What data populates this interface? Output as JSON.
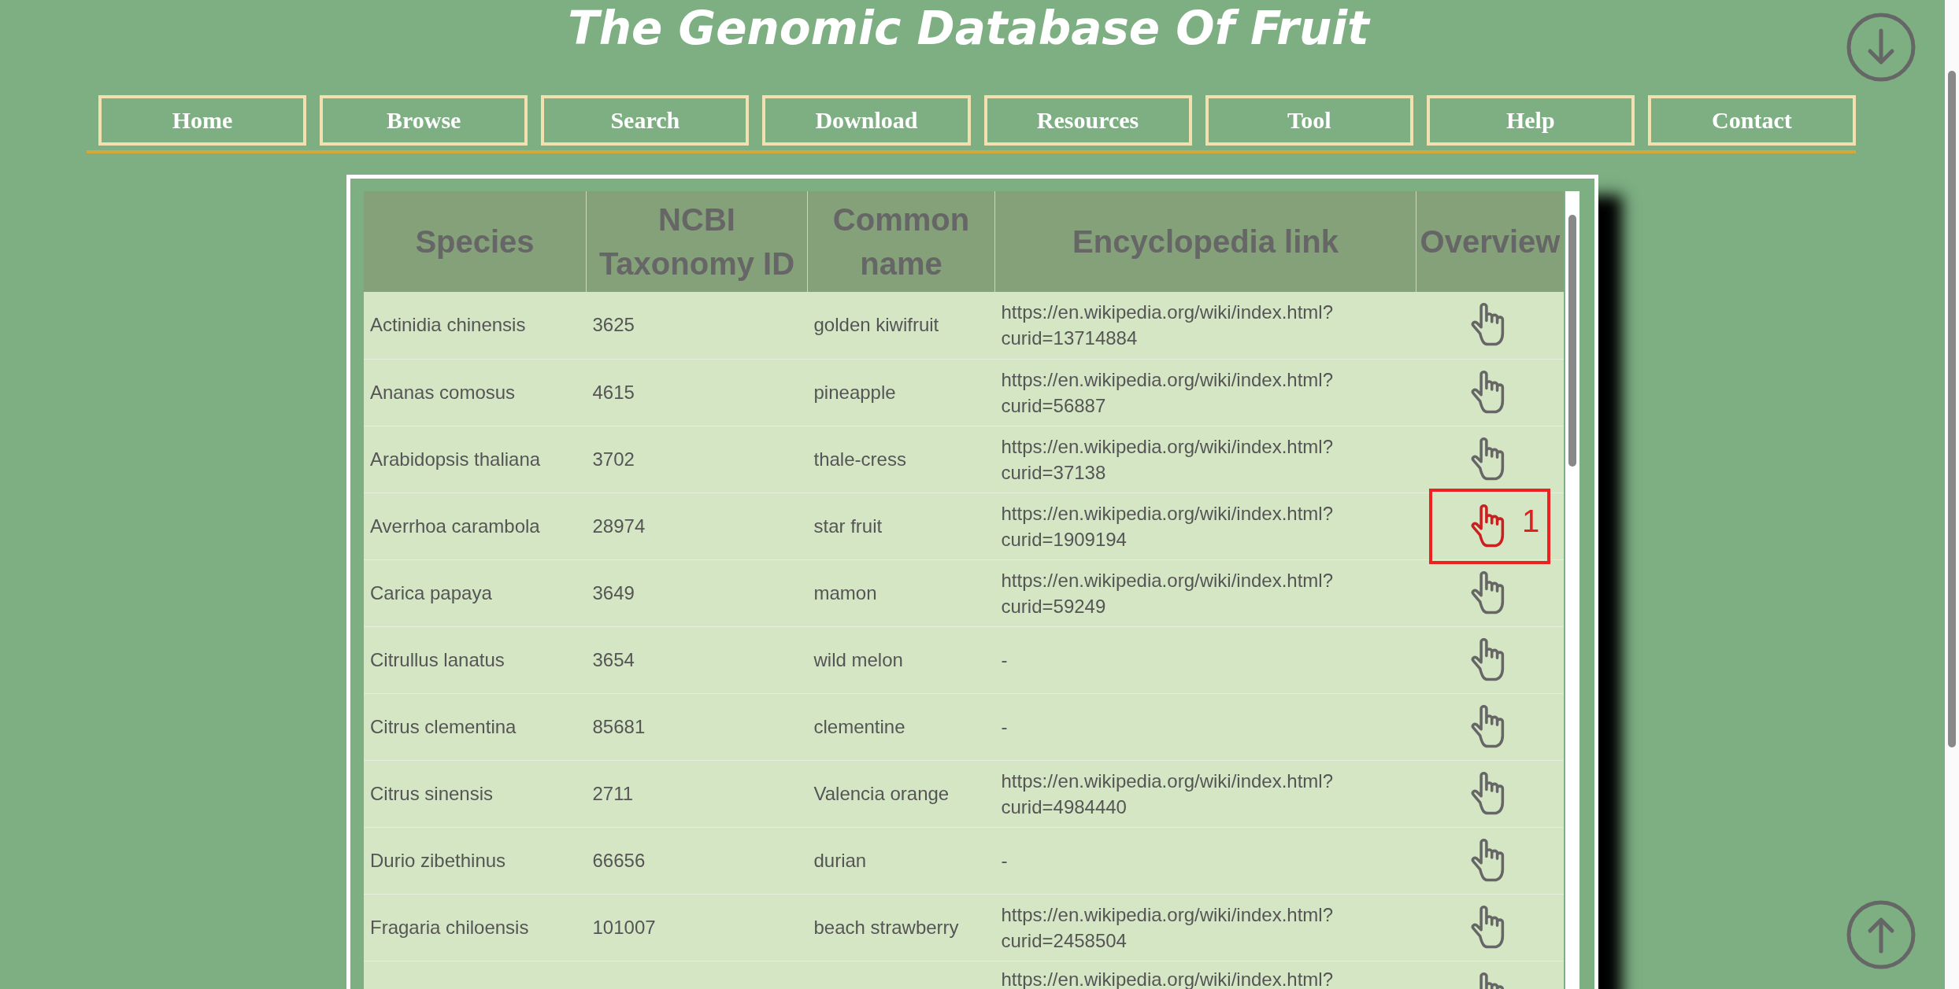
{
  "title": "The Genomic Database Of Fruit",
  "nav": [
    {
      "label": "Home"
    },
    {
      "label": "Browse"
    },
    {
      "label": "Search"
    },
    {
      "label": "Download"
    },
    {
      "label": "Resources"
    },
    {
      "label": "Tool"
    },
    {
      "label": "Help"
    },
    {
      "label": "Contact"
    }
  ],
  "table": {
    "columns": [
      "Species",
      "NCBI Taxonomy ID",
      "Common name",
      "Encyclopedia link",
      "Overview"
    ],
    "rows": [
      {
        "species": "Actinidia chinensis",
        "taxid": "3625",
        "common": "golden kiwifruit",
        "link": "https://en.wikipedia.org/wiki/index.html?curid=13714884",
        "highlighted": false
      },
      {
        "species": "Ananas comosus",
        "taxid": "4615",
        "common": "pineapple",
        "link": "https://en.wikipedia.org/wiki/index.html?curid=56887",
        "highlighted": false
      },
      {
        "species": "Arabidopsis thaliana",
        "taxid": "3702",
        "common": "thale-cress",
        "link": "https://en.wikipedia.org/wiki/index.html?curid=37138",
        "highlighted": false
      },
      {
        "species": "Averrhoa carambola",
        "taxid": "28974",
        "common": "star fruit",
        "link": "https://en.wikipedia.org/wiki/index.html?curid=1909194",
        "highlighted": true,
        "marker": "1"
      },
      {
        "species": "Carica papaya",
        "taxid": "3649",
        "common": "mamon",
        "link": "https://en.wikipedia.org/wiki/index.html?curid=59249",
        "highlighted": false
      },
      {
        "species": "Citrullus lanatus",
        "taxid": "3654",
        "common": "wild melon",
        "link": "-",
        "highlighted": false
      },
      {
        "species": "Citrus clementina",
        "taxid": "85681",
        "common": "clementine",
        "link": "-",
        "highlighted": false
      },
      {
        "species": "Citrus sinensis",
        "taxid": "2711",
        "common": "Valencia orange",
        "link": "https://en.wikipedia.org/wiki/index.html?curid=4984440",
        "highlighted": false
      },
      {
        "species": "Durio zibethinus",
        "taxid": "66656",
        "common": "durian",
        "link": "-",
        "highlighted": false
      },
      {
        "species": "Fragaria chiloensis",
        "taxid": "101007",
        "common": "beach strawberry",
        "link": "https://en.wikipedia.org/wiki/index.html?curid=2458504",
        "highlighted": false
      },
      {
        "link": "https://en.wikipedia.org/wiki/index.html?",
        "highlighted": false
      }
    ]
  }
}
